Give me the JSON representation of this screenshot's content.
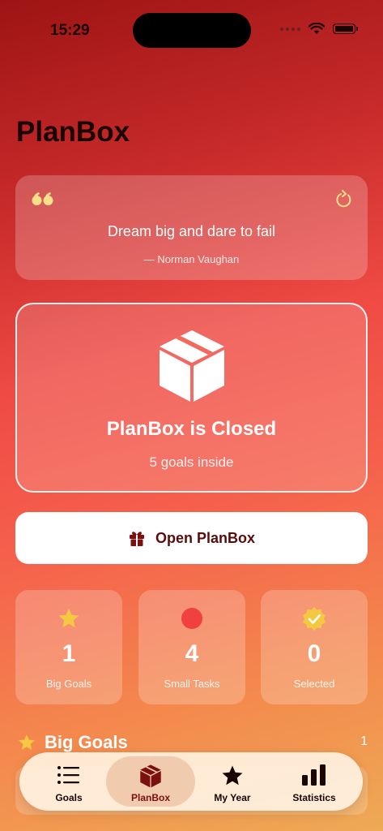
{
  "status_bar": {
    "time": "15:29"
  },
  "header": {
    "title": "PlanBox"
  },
  "quote": {
    "text": "Dream big and dare to fail",
    "author": "— Norman Vaughan"
  },
  "planbox": {
    "status": "PlanBox is Closed",
    "subtitle": "5 goals inside"
  },
  "open_button": {
    "label": "Open PlanBox"
  },
  "stats": [
    {
      "value": "1",
      "label": "Big Goals",
      "icon": "star-icon"
    },
    {
      "value": "4",
      "label": "Small Tasks",
      "icon": "circle-icon"
    },
    {
      "value": "0",
      "label": "Selected",
      "icon": "check-seal-icon"
    }
  ],
  "section": {
    "title": "Big Goals",
    "count": "1"
  },
  "tabs": [
    {
      "label": "Goals",
      "icon": "list-icon",
      "active": false
    },
    {
      "label": "PlanBox",
      "icon": "box-icon",
      "active": true
    },
    {
      "label": "My Year",
      "icon": "star-icon",
      "active": false
    },
    {
      "label": "Statistics",
      "icon": "bar-chart-icon",
      "active": false
    }
  ],
  "colors": {
    "accent_dark": "#7a1010",
    "star_yellow": "#f5c842",
    "dot_red": "#f04040",
    "quote_yellow": "#f8e08a"
  }
}
